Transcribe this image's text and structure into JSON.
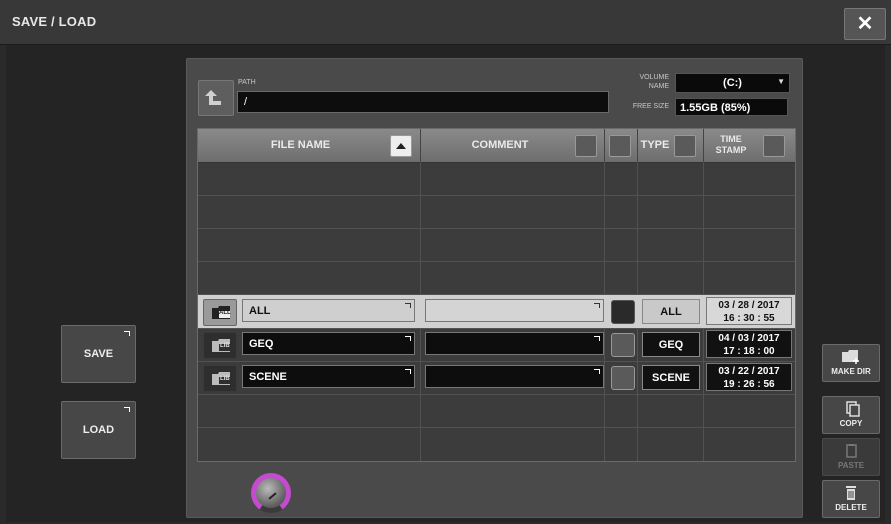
{
  "window": {
    "title": "SAVE / LOAD",
    "close_label": "✕"
  },
  "path": {
    "label": "PATH",
    "value": "/"
  },
  "volume": {
    "label_line1": "VOLUME",
    "label_line2": "NAME",
    "value": "(C:)",
    "free_label": "FREE SIZE",
    "free_value": "1.55GB (85%)"
  },
  "table": {
    "headers": {
      "file_name": "FILE NAME",
      "comment": "COMMENT",
      "type": "TYPE",
      "time_stamp_line1": "TIME",
      "time_stamp_line2": "STAMP"
    },
    "rows": [
      {
        "folder_tag": "ALL",
        "name": "ALL",
        "comment": "",
        "type": "ALL",
        "date": "03 / 28 / 2017",
        "time": "16 : 30 : 55",
        "selected": true
      },
      {
        "folder_tag": "LIB",
        "name": "GEQ",
        "comment": "",
        "type": "GEQ",
        "date": "04 / 03 / 2017",
        "time": "17 : 18 : 00",
        "selected": false
      },
      {
        "folder_tag": "LIB",
        "name": "SCENE",
        "comment": "",
        "type": "SCENE",
        "date": "03 / 22 / 2017",
        "time": "19 : 26 : 56",
        "selected": false
      }
    ]
  },
  "buttons": {
    "save": "SAVE",
    "load": "LOAD",
    "make_dir": "MAKE DIR",
    "copy": "COPY",
    "paste": "PASTE",
    "delete": "DELETE"
  },
  "colors": {
    "accent_knob": "#c44bd0",
    "selected_row": "#d0d0d0"
  }
}
